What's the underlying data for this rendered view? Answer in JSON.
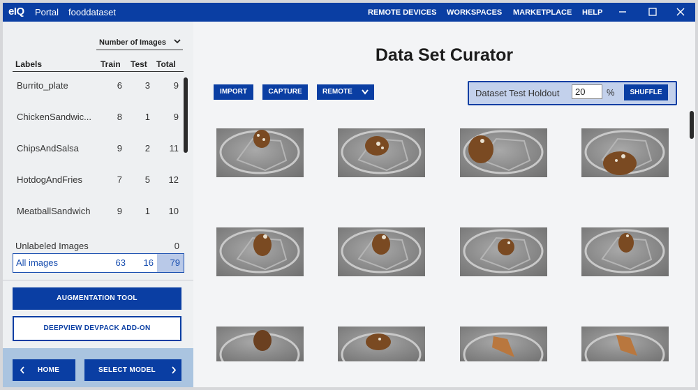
{
  "titlebar": {
    "logo": "eIQ",
    "portal_label": "Portal",
    "dataset_name": "fooddataset",
    "nav": [
      "REMOTE DEVICES",
      "WORKSPACES",
      "MARKETPLACE",
      "HELP"
    ]
  },
  "sidebar": {
    "metric_selector": "Number of Images",
    "columns": {
      "labels": "Labels",
      "train": "Train",
      "test": "Test",
      "total": "Total"
    },
    "labels": [
      {
        "name": "Burrito_plate",
        "train": "6",
        "test": "3",
        "total": "9"
      },
      {
        "name": "ChickenSandwic...",
        "train": "8",
        "test": "1",
        "total": "9"
      },
      {
        "name": "ChipsAndSalsa",
        "train": "9",
        "test": "2",
        "total": "11"
      },
      {
        "name": "HotdogAndFries",
        "train": "7",
        "test": "5",
        "total": "12"
      },
      {
        "name": "MeatballSandwich",
        "train": "9",
        "test": "1",
        "total": "10"
      }
    ],
    "unlabeled": {
      "name": "Unlabeled Images",
      "total": "0"
    },
    "all_images": {
      "name": "All images",
      "train": "63",
      "test": "16",
      "total": "79"
    },
    "augmentation_button": "AUGMENTATION TOOL",
    "devpack_button": "DEEPVIEW DEVPACK ADD-ON",
    "home_button": "HOME",
    "select_model_button": "SELECT MODEL"
  },
  "main": {
    "title": "Data Set Curator",
    "import_button": "IMPORT",
    "capture_button": "CAPTURE",
    "remote_button": "REMOTE",
    "holdout_label": "Dataset Test Holdout",
    "holdout_value": "20",
    "holdout_unit": "%",
    "shuffle_button": "SHUFFLE"
  },
  "theme": {
    "primary": "#0a3ea3",
    "sidebar_bg": "#eef0f2",
    "footer_bg": "#aac4e0",
    "selected_total_bg": "#b9c9e8"
  }
}
